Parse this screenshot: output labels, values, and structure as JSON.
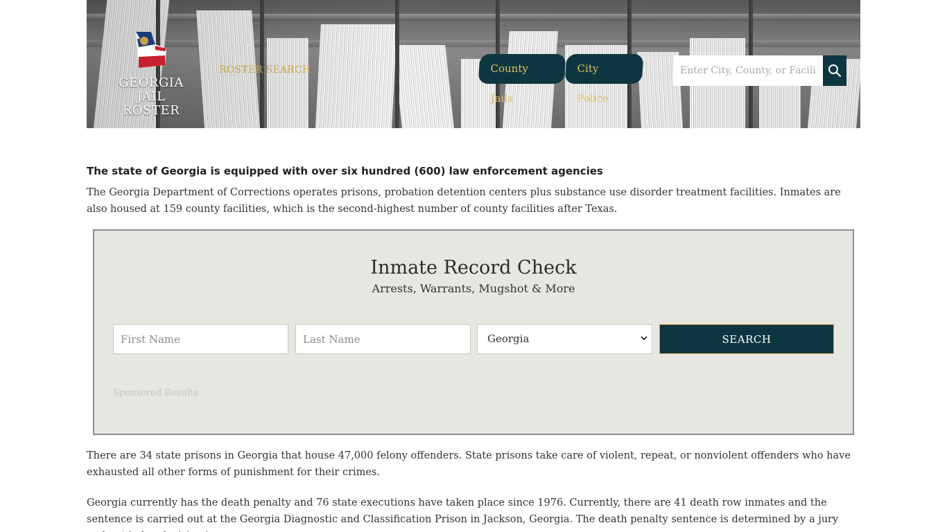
{
  "header": {
    "logo_line1": "GEORGIA",
    "logo_line2": "JAIL ROSTER",
    "roster_search_link": "ROSTER SEARCH",
    "nav": [
      {
        "label": "County Jails"
      },
      {
        "label": "City Police"
      }
    ],
    "search_placeholder": "Enter City, County, or Facility"
  },
  "intro": {
    "heading": "The state of Georgia is equipped with over six hundred (600) law enforcement agencies",
    "paragraph": "The Georgia Department of Corrections operates prisons, probation detention centers plus substance use disorder treatment facilities. Inmates are also housed at 159 county facilities, which is the second-highest number of county facilities after Texas."
  },
  "record_check": {
    "title": "Inmate Record Check",
    "subtitle": "Arrests, Warrants, Mugshot & More",
    "first_name_placeholder": "First Name",
    "last_name_placeholder": "Last Name",
    "state_selected": "Georgia",
    "search_button": "SEARCH",
    "sponsored_label": "Sponsored Results"
  },
  "body": {
    "paragraph1": "There are 34 state prisons in Georgia that house 47,000 felony offenders. State prisons take care of violent, repeat, or nonviolent offenders who have exhausted all other forms of punishment for their crimes.",
    "paragraph2": "Georgia currently has the death penalty and 76 state executions have taken place since 1976. Currently, there are 41 death row inmates and the sentence is carried out at the Georgia Diagnostic and Classification Prison in Jackson, Georgia. The death penalty sentence is determined by a jury and not judge decision in"
  },
  "colors": {
    "nav_bg": "#0e3640",
    "nav_text": "#e3c065",
    "gold": "#c8a24a",
    "panel_bg": "#e8e6e0"
  }
}
